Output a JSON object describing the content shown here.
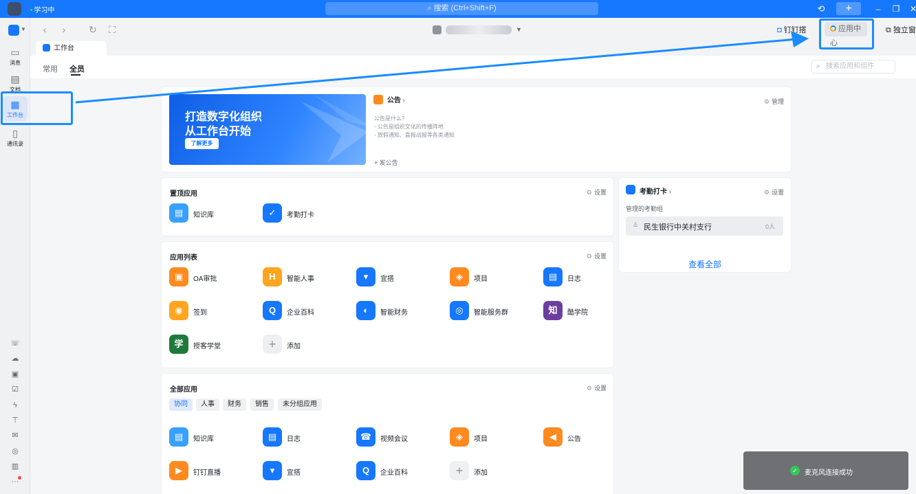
{
  "titlebar": {
    "status": "学习中",
    "search_placeholder": "搜索 (Ctrl+Shift+F)"
  },
  "rail": {
    "items": [
      {
        "label": "消息"
      },
      {
        "label": "文档"
      },
      {
        "label": "工作台"
      },
      {
        "label": "通讯录"
      }
    ]
  },
  "nav": {
    "ding_label": "钉钉搭",
    "app_center_label": "应用中心",
    "standalone_label": "独立窗口"
  },
  "doctab": {
    "label": "工作台"
  },
  "subnav": {
    "tabs": [
      "常用",
      "全员"
    ],
    "search_placeholder": "搜索应用和组件"
  },
  "banner": {
    "line1": "打造数字化组织",
    "line2": "从工作台开始",
    "more_label": "了解更多"
  },
  "announcement": {
    "title": "公告",
    "manage_label": "管理",
    "question": "公告是什么?",
    "lines": [
      "- 公告是组织文化的传播阵地",
      "- 放假通知、喜报战报等各类通知"
    ],
    "post_label": "发公告"
  },
  "pinned": {
    "title": "置顶应用",
    "settings_label": "设置",
    "apps": [
      {
        "name": "知识库",
        "color": "#3aa0ff"
      },
      {
        "name": "考勤打卡",
        "color": "#1677ff"
      }
    ]
  },
  "app_list": {
    "title": "应用列表",
    "settings_label": "设置",
    "apps": [
      {
        "name": "OA审批",
        "color": "#ff8a1f",
        "glyph": "▣"
      },
      {
        "name": "智能人事",
        "color": "#ffa51f",
        "glyph": "H"
      },
      {
        "name": "宜搭",
        "color": "#1677ff",
        "glyph": "▾"
      },
      {
        "name": "项目",
        "color": "#ff8a1f",
        "glyph": "◈"
      },
      {
        "name": "日志",
        "color": "#1677ff",
        "glyph": "▤"
      },
      {
        "name": "签到",
        "color": "#ffa51f",
        "glyph": "◉"
      },
      {
        "name": "企业百科",
        "color": "#1677ff",
        "glyph": "Q"
      },
      {
        "name": "智能财务",
        "color": "#1677ff",
        "glyph": "◐"
      },
      {
        "name": "智能服务群",
        "color": "#1677ff",
        "glyph": "◎"
      },
      {
        "name": "酷学院",
        "color": "#6b3fa0",
        "glyph": "知"
      },
      {
        "name": "授客学堂",
        "color": "#1e7a3a",
        "glyph": "学"
      },
      {
        "name": "添加",
        "color": "#eff0f1",
        "glyph": "+"
      }
    ]
  },
  "all_apps": {
    "title": "全部应用",
    "settings_label": "设置",
    "chips": [
      "协同",
      "人事",
      "财务",
      "销售",
      "未分组应用"
    ],
    "apps": [
      {
        "name": "知识库",
        "color": "#3aa0ff",
        "glyph": "▤"
      },
      {
        "name": "日志",
        "color": "#1677ff",
        "glyph": "▤"
      },
      {
        "name": "视频会议",
        "color": "#1677ff",
        "glyph": "☎"
      },
      {
        "name": "项目",
        "color": "#ff8a1f",
        "glyph": "◈"
      },
      {
        "name": "公告",
        "color": "#ff8a1f",
        "glyph": "◀"
      },
      {
        "name": "钉钉直播",
        "color": "#ff8a1f",
        "glyph": "▶"
      },
      {
        "name": "宜搭",
        "color": "#1677ff",
        "glyph": "▾"
      },
      {
        "name": "企业百科",
        "color": "#1677ff",
        "glyph": "Q"
      },
      {
        "name": "添加",
        "color": "#eff0f1",
        "glyph": "+"
      }
    ]
  },
  "attendance": {
    "title": "考勤打卡",
    "settings_label": "设置",
    "subtitle": "管理的考勤组",
    "group_name": "民生银行中关村支行",
    "group_count": "0人",
    "view_all": "查看全部"
  },
  "toast": {
    "message": "麦克风连接成功"
  }
}
